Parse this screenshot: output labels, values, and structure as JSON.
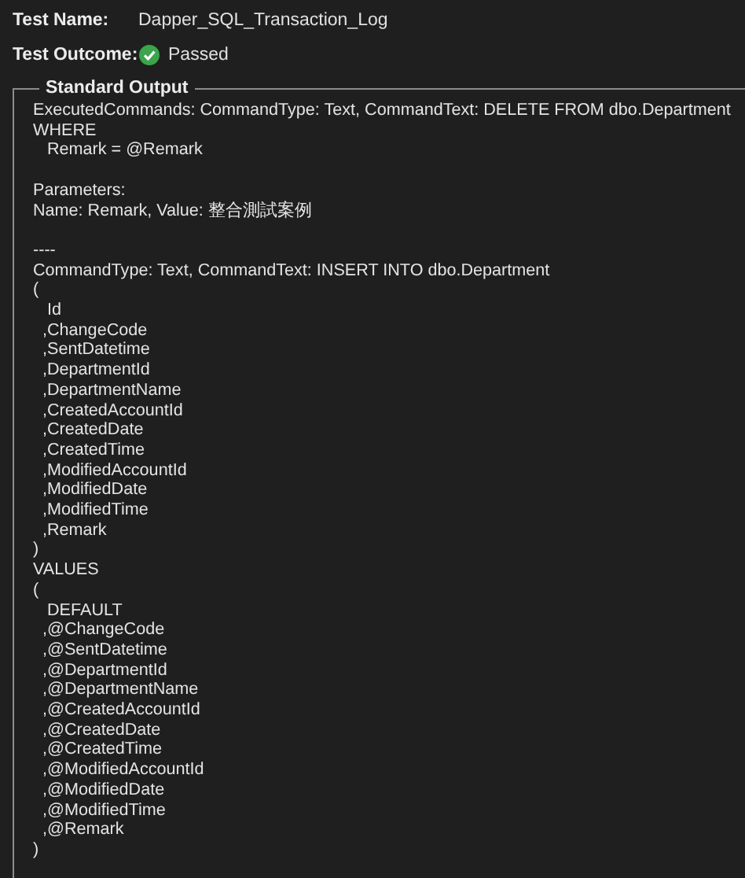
{
  "test_name": {
    "label": "Test Name:",
    "value": "Dapper_SQL_Transaction_Log"
  },
  "test_outcome": {
    "label": "Test Outcome:",
    "passed": true,
    "value": "Passed"
  },
  "standard_output": {
    "title": "Standard Output",
    "blocks": [
      [
        "ExecutedCommands: CommandType: Text, CommandText: DELETE FROM dbo.Department",
        "WHERE",
        "   Remark = @Remark"
      ],
      [
        "Parameters:",
        "Name: Remark, Value: 整合測試案例"
      ],
      [
        "----",
        "CommandType: Text, CommandText: INSERT INTO dbo.Department",
        "(",
        "   Id",
        "  ,ChangeCode",
        "  ,SentDatetime",
        "  ,DepartmentId",
        "  ,DepartmentName",
        "  ,CreatedAccountId",
        "  ,CreatedDate",
        "  ,CreatedTime",
        "  ,ModifiedAccountId",
        "  ,ModifiedDate",
        "  ,ModifiedTime",
        "  ,Remark",
        ")",
        "VALUES",
        "(",
        "   DEFAULT",
        "  ,@ChangeCode",
        "  ,@SentDatetime",
        "  ,@DepartmentId",
        "  ,@DepartmentName",
        "  ,@CreatedAccountId",
        "  ,@CreatedDate",
        "  ,@CreatedTime",
        "  ,@ModifiedAccountId",
        "  ,@ModifiedDate",
        "  ,@ModifiedTime",
        "  ,@Remark",
        ")"
      ]
    ]
  }
}
